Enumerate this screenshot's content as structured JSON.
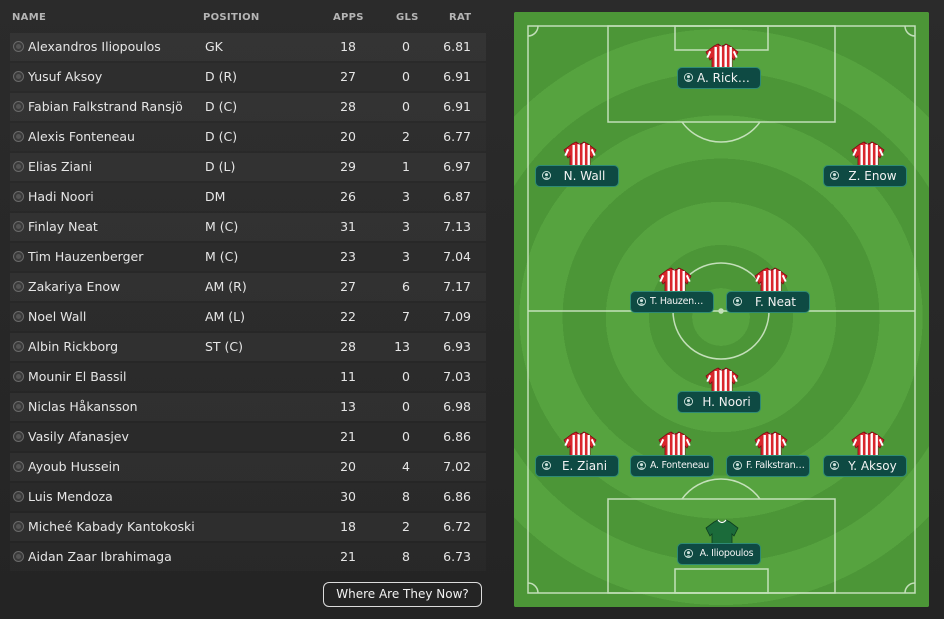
{
  "columns": {
    "name": "NAME",
    "position": "POSITION",
    "apps": "APPS",
    "gls": "GLS",
    "rat": "RAT"
  },
  "players": [
    {
      "name": "Alexandros Iliopoulos",
      "position": "GK",
      "apps": "18",
      "gls": "0",
      "rat": "6.81"
    },
    {
      "name": "Yusuf Aksoy",
      "position": "D (R)",
      "apps": "27",
      "gls": "0",
      "rat": "6.91"
    },
    {
      "name": "Fabian Falkstrand Ransjö",
      "position": "D (C)",
      "apps": "28",
      "gls": "0",
      "rat": "6.91"
    },
    {
      "name": "Alexis Fonteneau",
      "position": "D (C)",
      "apps": "20",
      "gls": "2",
      "rat": "6.77"
    },
    {
      "name": "Elias Ziani",
      "position": "D (L)",
      "apps": "29",
      "gls": "1",
      "rat": "6.97"
    },
    {
      "name": "Hadi Noori",
      "position": "DM",
      "apps": "26",
      "gls": "3",
      "rat": "6.87"
    },
    {
      "name": "Finlay Neat",
      "position": "M (C)",
      "apps": "31",
      "gls": "3",
      "rat": "7.13"
    },
    {
      "name": "Tim Hauzenberger",
      "position": "M (C)",
      "apps": "23",
      "gls": "3",
      "rat": "7.04"
    },
    {
      "name": "Zakariya Enow",
      "position": "AM (R)",
      "apps": "27",
      "gls": "6",
      "rat": "7.17"
    },
    {
      "name": "Noel Wall",
      "position": "AM (L)",
      "apps": "22",
      "gls": "7",
      "rat": "7.09"
    },
    {
      "name": "Albin Rickborg",
      "position": "ST (C)",
      "apps": "28",
      "gls": "13",
      "rat": "6.93"
    },
    {
      "name": "Mounir El Bassil",
      "position": "",
      "apps": "11",
      "gls": "0",
      "rat": "7.03"
    },
    {
      "name": "Niclas Håkansson",
      "position": "",
      "apps": "13",
      "gls": "0",
      "rat": "6.98"
    },
    {
      "name": "Vasily Afanasjev",
      "position": "",
      "apps": "21",
      "gls": "0",
      "rat": "6.86"
    },
    {
      "name": "Ayoub Hussein",
      "position": "",
      "apps": "20",
      "gls": "4",
      "rat": "7.02"
    },
    {
      "name": "Luis Mendoza",
      "position": "",
      "apps": "30",
      "gls": "8",
      "rat": "6.86"
    },
    {
      "name": "Micheé Kabady Kantokoski",
      "position": "",
      "apps": "18",
      "gls": "2",
      "rat": "6.72"
    },
    {
      "name": "Aidan Zaar Ibrahimaga",
      "position": "",
      "apps": "21",
      "gls": "8",
      "rat": "6.73"
    }
  ],
  "where_button": "Where Are They Now?",
  "pitch": {
    "grass_color": "#4f9a3a",
    "stripe_color": "#5aa845",
    "line_color": "#d8ecd0",
    "kit_colors": {
      "outfield_primary": "#d9262c",
      "outfield_secondary": "#ffffff",
      "keeper": "#1b6b3a"
    },
    "tags": {
      "rickborg": "A. Rickborg",
      "wall": "N. Wall",
      "enow": "Z. Enow",
      "hauzenberger": "T. Hauzenberger",
      "neat": "F. Neat",
      "noori": "H. Noori",
      "ziani": "E. Ziani",
      "fonteneau": "A. Fonteneau",
      "falkstrand": "F. Falkstrand Ra...",
      "aksoy": "Y. Aksoy",
      "iliopoulos": "A. Iliopoulos"
    }
  }
}
